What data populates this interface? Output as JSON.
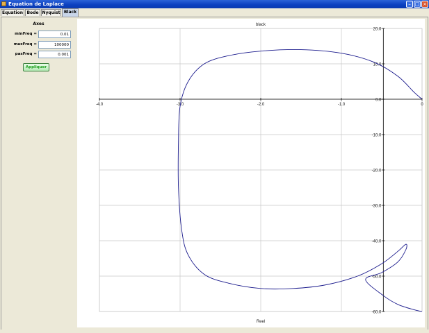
{
  "window": {
    "title": "Equation de Laplace"
  },
  "tabs": [
    {
      "label": "Equation"
    },
    {
      "label": "Bode"
    },
    {
      "label": "Nyquist"
    },
    {
      "label": "Black",
      "active": true
    }
  ],
  "left_panel": {
    "title": "Axes",
    "fields": [
      {
        "label": "minFreq =",
        "value": "0.01"
      },
      {
        "label": "maxFreq =",
        "value": "100000"
      },
      {
        "label": "pasFreq =",
        "value": "0.001"
      }
    ],
    "apply_label": "Appliquer"
  },
  "colors": {
    "accent": "#2a5bd7",
    "curve": "#1a1a8c",
    "apply_text": "#22a022"
  },
  "chart_data": {
    "type": "line",
    "title": "black",
    "xlabel": "Reel",
    "ylabel": "",
    "xlim": [
      -4.0,
      0.0
    ],
    "ylim": [
      -60.0,
      20.0
    ],
    "x_ticks": [
      "-4.0",
      "-3.0",
      "-2.0",
      "-1.0",
      "0"
    ],
    "y_ticks": [
      "20.0",
      "10.0",
      "0.0",
      "-10.0",
      "-20.0",
      "-30.0",
      "-40.0",
      "-50.0",
      "-60.0"
    ],
    "grid": true,
    "series": [
      {
        "x": [
          0.0,
          -0.1,
          -0.3,
          -0.6,
          -1.0,
          -1.5,
          -2.0,
          -2.4,
          -2.7,
          -2.9,
          -3.0,
          -3.02,
          -3.02,
          -2.98,
          -2.9,
          -2.7,
          -2.4,
          -2.0,
          -1.6,
          -1.2,
          -0.8,
          -0.5,
          -0.3,
          -0.2,
          -0.2,
          -0.3,
          -0.5,
          -0.7,
          -0.48,
          -0.3,
          -0.1,
          0.0
        ],
        "y": [
          0.0,
          2.0,
          6.5,
          10.5,
          13.0,
          14.0,
          13.6,
          12.3,
          10.0,
          5.0,
          -2.0,
          -12.0,
          -25.0,
          -37.0,
          -44.0,
          -49.5,
          -52.0,
          -53.5,
          -53.5,
          -52.5,
          -50.0,
          -46.5,
          -43.0,
          -41.0,
          -42.5,
          -46.0,
          -49.0,
          -51.0,
          -55.5,
          -58.0,
          -59.5,
          -60.0
        ]
      }
    ]
  }
}
